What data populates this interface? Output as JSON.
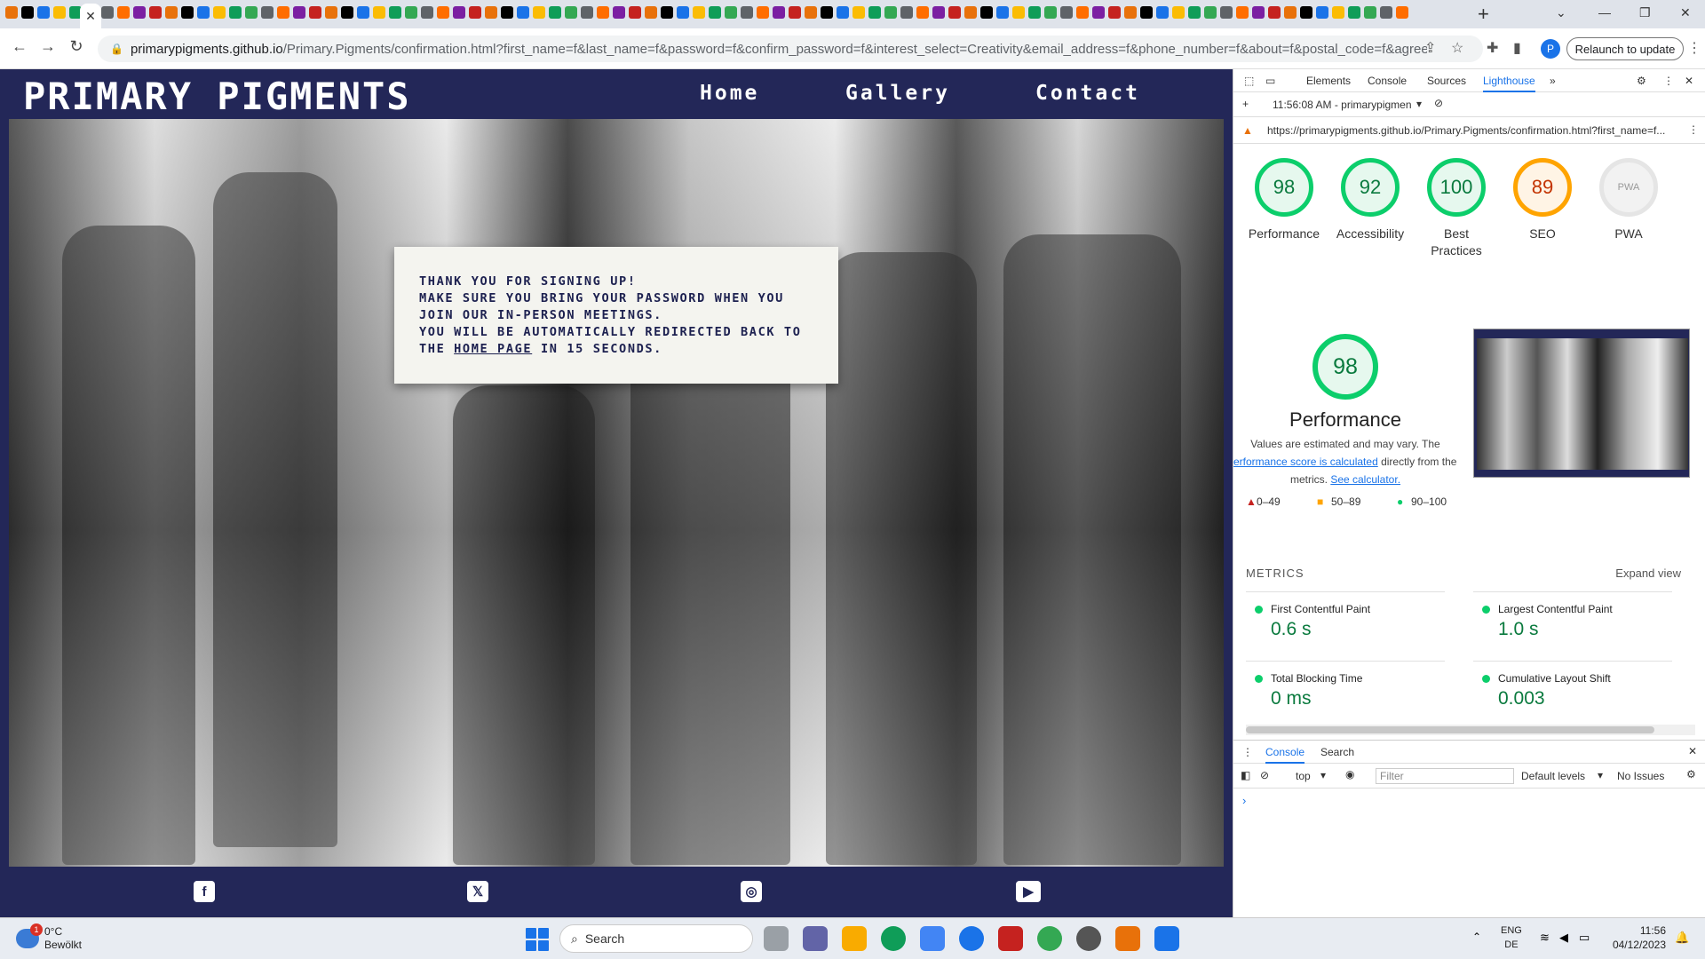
{
  "browser": {
    "url_host": "primarypigments.github.io",
    "url_path": "/Primary.Pigments/confirmation.html?first_name=f&last_name=f&password=f&confirm_password=f&interest_select=Creativity&email_address=f&phone_number=f&about=f&postal_code=f&agreed=on",
    "relaunch_label": "Relaunch to update",
    "profile_initial": "P"
  },
  "site": {
    "brand": "PRIMARY PIGMENTS",
    "nav": {
      "home": "Home",
      "gallery": "Gallery",
      "contact": "Contact"
    },
    "message": {
      "line1": "THANK YOU FOR SIGNING UP!",
      "line2": "MAKE SURE YOU BRING YOUR PASSWORD WHEN YOU",
      "line3": "JOIN OUR IN-PERSON MEETINGS.",
      "line4": "YOU WILL BE AUTOMATICALLY REDIRECTED BACK TO",
      "line5_pre": "THE ",
      "link": "HOME PAGE",
      "line5_post": " IN 15 SECONDS."
    },
    "social": [
      "facebook-icon",
      "x-icon",
      "instagram-icon",
      "youtube-icon"
    ]
  },
  "devtools": {
    "tabs": {
      "elements": "Elements",
      "console": "Console",
      "sources": "Sources",
      "lighthouse": "Lighthouse"
    },
    "report": "11:56:08 AM - primarypigmen",
    "report_url": "https://primarypigments.github.io/Primary.Pigments/confirmation.html?first_name=f...",
    "gauges": [
      {
        "score": "98",
        "label": "Performance"
      },
      {
        "score": "92",
        "label": "Accessibility"
      },
      {
        "score": "100",
        "label": "Best Practices"
      },
      {
        "score": "89",
        "label": "SEO"
      },
      {
        "score": "PWA",
        "label": "PWA"
      }
    ],
    "performance": {
      "score": "98",
      "title": "Performance",
      "desc1": "Values are estimated and may vary. The",
      "desc2_link": "erformance score is calculated",
      "desc2_post": " directly from these",
      "desc3_pre": "metrics. ",
      "desc3_link": "See calculator.",
      "legend": [
        "0–49",
        "50–89",
        "90–100"
      ]
    },
    "metrics": {
      "heading": "METRICS",
      "expand": "Expand view",
      "items": [
        {
          "label": "First Contentful Paint",
          "value": "0.6 s"
        },
        {
          "label": "Largest Contentful Paint",
          "value": "1.0 s"
        },
        {
          "label": "Total Blocking Time",
          "value": "0 ms"
        },
        {
          "label": "Cumulative Layout Shift",
          "value": "0.003"
        }
      ]
    },
    "drawer": {
      "console": "Console",
      "search": "Search",
      "context": "top",
      "filter_placeholder": "Filter",
      "levels": "Default levels",
      "issues": "No Issues"
    }
  },
  "taskbar": {
    "weather_temp": "0°C",
    "weather_desc": "Bewölkt",
    "weather_badge": "1",
    "search_label": "Search",
    "lang1": "ENG",
    "lang2": "DE",
    "time": "11:56",
    "date": "04/12/2023"
  }
}
